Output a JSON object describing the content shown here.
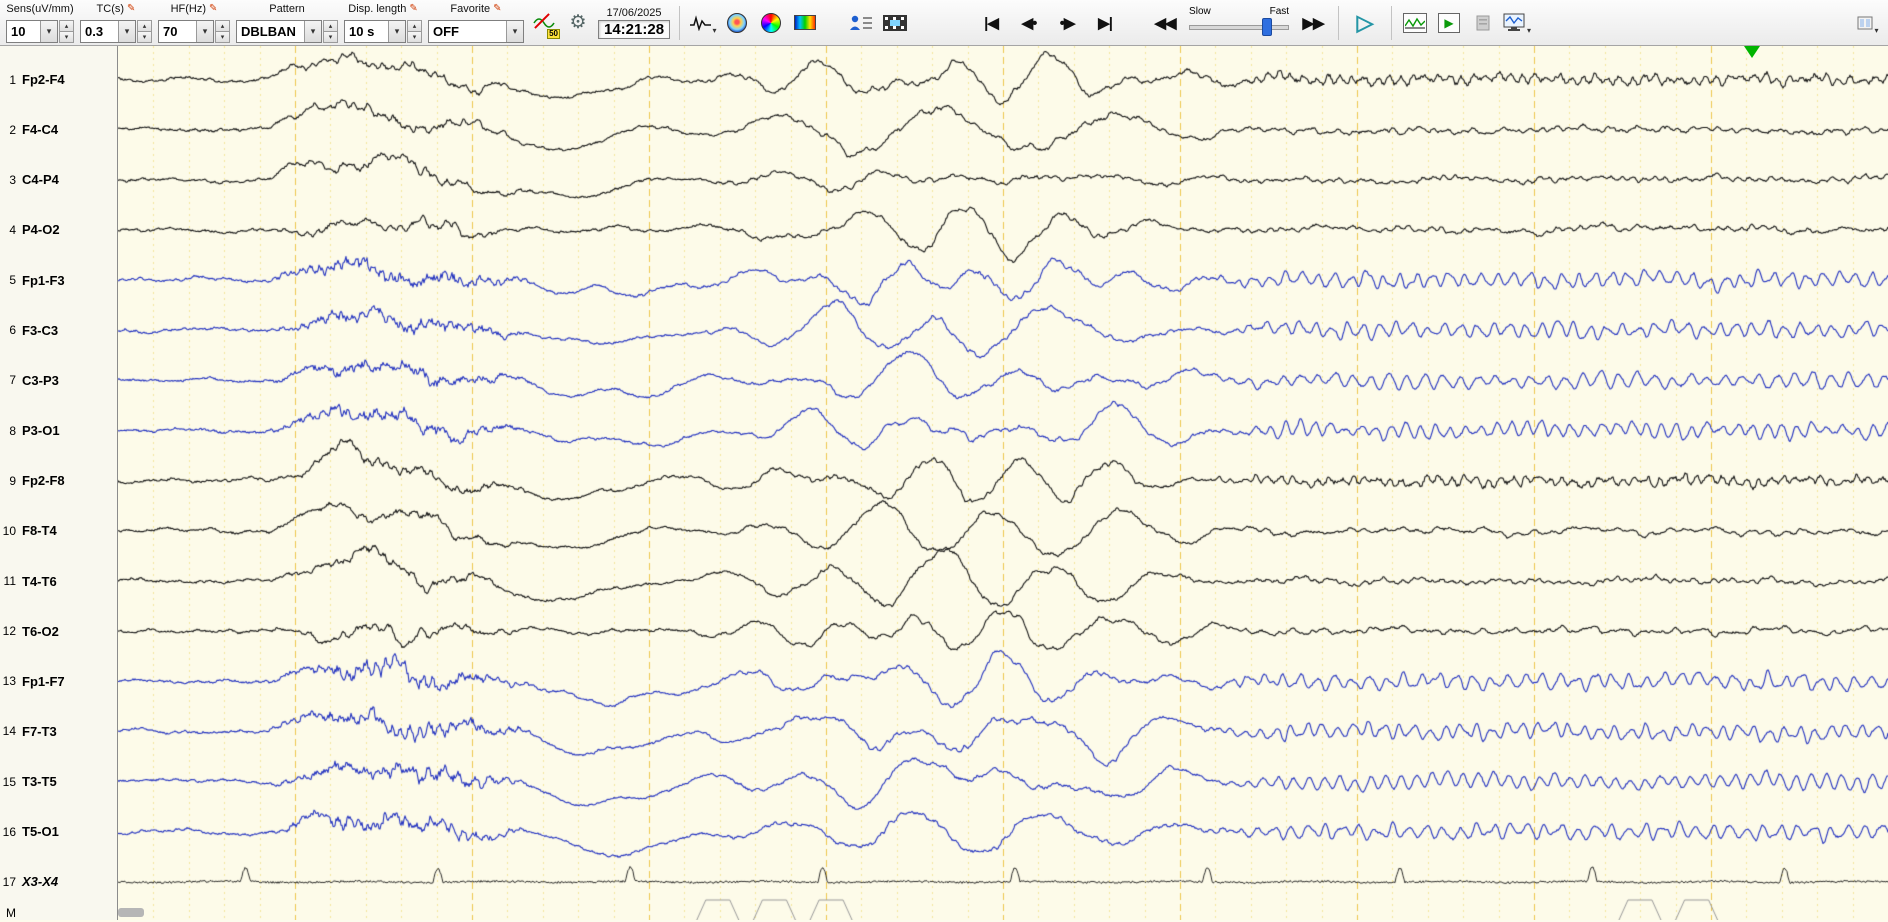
{
  "toolbar": {
    "fields": [
      {
        "label": "Sens(uV/mm)",
        "value": "10",
        "pencil": false,
        "spinner": true
      },
      {
        "label": "TC(s)",
        "value": "0.3",
        "pencil": true,
        "spinner": true
      },
      {
        "label": "HF(Hz)",
        "value": "70",
        "pencil": true,
        "spinner": true
      },
      {
        "label": "Pattern",
        "value": "DBLBAN",
        "pencil": false,
        "spinner": true
      },
      {
        "label": "Disp. length",
        "value": "10 s",
        "pencil": true,
        "spinner": true
      },
      {
        "label": "Favorite",
        "value": "OFF",
        "pencil": true,
        "spinner": false
      }
    ],
    "notch_badge": "50",
    "datetime": {
      "date": "17/06/2025",
      "time": "14:21:28"
    },
    "transport": {
      "first": "|◀",
      "back": "◀•",
      "fwd": "•▶",
      "last": "▶|",
      "rewind": "◀◀",
      "ffwd": "▶▶",
      "play": "▷",
      "green_play": "▶"
    },
    "speed": {
      "slow_label": "Slow",
      "fast_label": "Fast",
      "thumb_pct": 72
    }
  },
  "channels": [
    {
      "num": "1",
      "label": "Fp2-F4",
      "color": "black"
    },
    {
      "num": "2",
      "label": "F4-C4",
      "color": "black"
    },
    {
      "num": "3",
      "label": "C4-P4",
      "color": "black"
    },
    {
      "num": "4",
      "label": "P4-O2",
      "color": "black"
    },
    {
      "num": "5",
      "label": "Fp1-F3",
      "color": "blue"
    },
    {
      "num": "6",
      "label": "F3-C3",
      "color": "blue"
    },
    {
      "num": "7",
      "label": "C3-P3",
      "color": "blue"
    },
    {
      "num": "8",
      "label": "P3-O1",
      "color": "blue"
    },
    {
      "num": "9",
      "label": "Fp2-F8",
      "color": "black"
    },
    {
      "num": "10",
      "label": "F8-T4",
      "color": "black"
    },
    {
      "num": "11",
      "label": "T4-T6",
      "color": "black"
    },
    {
      "num": "12",
      "label": "T6-O2",
      "color": "black"
    },
    {
      "num": "13",
      "label": "Fp1-F7",
      "color": "blue"
    },
    {
      "num": "14",
      "label": "F7-T3",
      "color": "blue"
    },
    {
      "num": "15",
      "label": "T3-T5",
      "color": "blue"
    },
    {
      "num": "16",
      "label": "T5-O1",
      "color": "blue"
    },
    {
      "num": "17",
      "label": "X3-X4",
      "color": "black",
      "italic": true,
      "flat": true
    },
    {
      "num": "M",
      "label": "",
      "color": "black",
      "trace": false
    }
  ],
  "grid": {
    "seconds": 10,
    "minor_per_major": 5
  },
  "palette": {
    "bg": "#fdfbe9",
    "grid_minor": "#f3e69b",
    "grid_major": "#eec84e",
    "black": "#161616",
    "blue": "#2433c0",
    "event": "#9a9a9a"
  },
  "events": {
    "trapezoids_s": [
      3.27,
      3.59,
      3.91,
      8.48,
      8.8
    ]
  },
  "cursor": {
    "time_s": 9.23
  }
}
